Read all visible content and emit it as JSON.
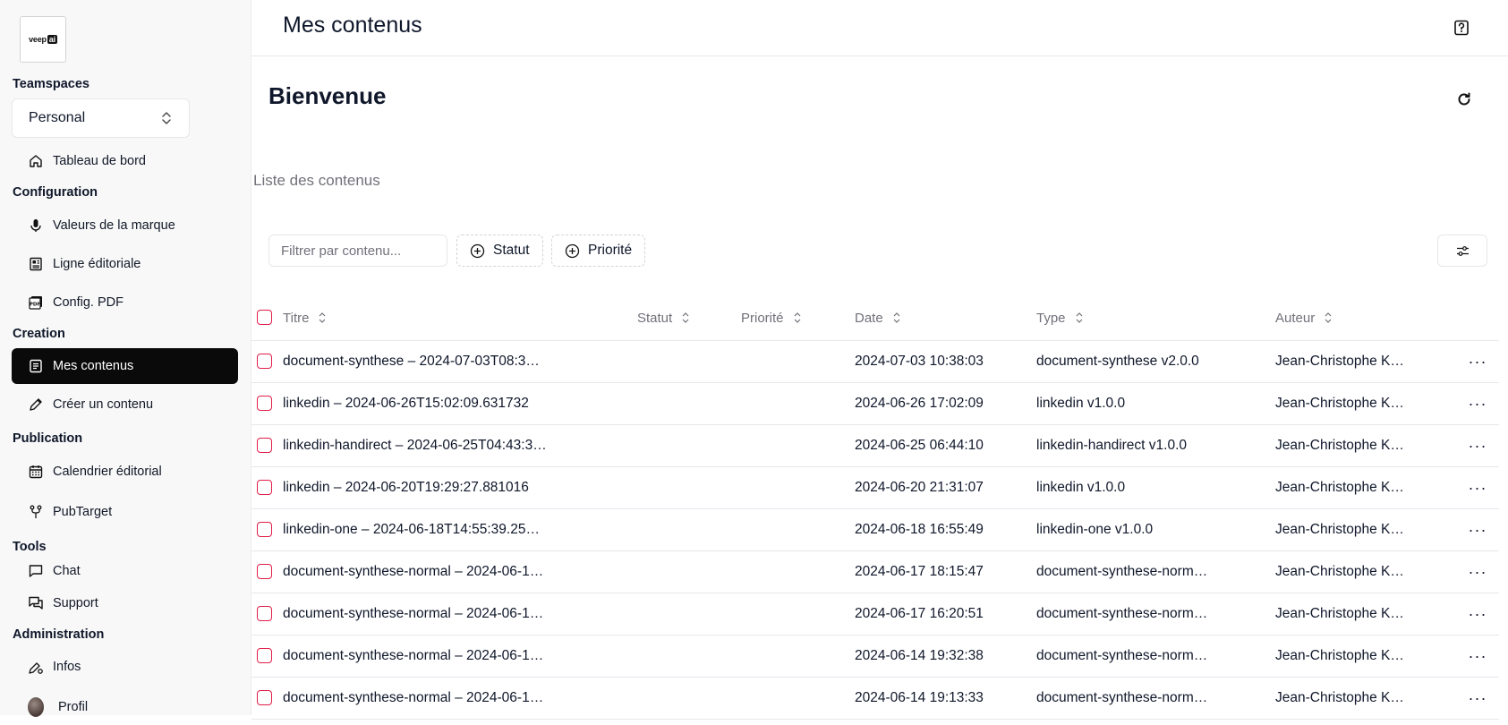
{
  "logo": {
    "brand": "veep",
    "suffix": "ai"
  },
  "sidebar": {
    "teamspaces_title": "Teamspaces",
    "teamspace_value": "Personal",
    "dashboard_label": "Tableau de bord",
    "sections": [
      {
        "title": "Configuration",
        "items": [
          {
            "label": "Valeurs de la marque",
            "icon": "mic-icon"
          },
          {
            "label": "Ligne éditoriale",
            "icon": "newspaper-icon"
          },
          {
            "label": "Config. PDF",
            "icon": "pdf-icon"
          }
        ]
      },
      {
        "title": "Creation",
        "items": [
          {
            "label": "Mes contenus",
            "icon": "document-list-icon",
            "active": true
          },
          {
            "label": "Créer un contenu",
            "icon": "pencil-icon"
          }
        ]
      },
      {
        "title": "Publication",
        "items": [
          {
            "label": "Calendrier éditorial",
            "icon": "calendar-icon"
          },
          {
            "label": "PubTarget",
            "icon": "fork-icon"
          }
        ]
      },
      {
        "title": "Tools",
        "items": [
          {
            "label": "Chat",
            "icon": "chat-icon"
          },
          {
            "label": "Support",
            "icon": "support-chat-icon"
          }
        ]
      },
      {
        "title": "Administration",
        "items": [
          {
            "label": "Infos",
            "icon": "pen-gear-icon"
          },
          {
            "label": "Profil",
            "icon": "avatar"
          }
        ]
      }
    ]
  },
  "header": {
    "title": "Mes contenus"
  },
  "main": {
    "welcome": "Bienvenue",
    "list_title": "Liste des contenus",
    "filter_placeholder": "Filtrer par contenu...",
    "chip_status": "Statut",
    "chip_priority": "Priorité"
  },
  "table": {
    "columns": [
      "Titre",
      "Statut",
      "Priorité",
      "Date",
      "Type",
      "Auteur"
    ],
    "rows": [
      {
        "title": "document-synthese – 2024-07-03T08:3…",
        "status": "",
        "priority": "",
        "date": "2024-07-03 10:38:03",
        "type": "document-synthese v2.0.0",
        "author": "Jean-Christophe K…"
      },
      {
        "title": "linkedin – 2024-06-26T15:02:09.631732",
        "status": "",
        "priority": "",
        "date": "2024-06-26 17:02:09",
        "type": "linkedin v1.0.0",
        "author": "Jean-Christophe K…"
      },
      {
        "title": "linkedin-handirect – 2024-06-25T04:43:3…",
        "status": "",
        "priority": "",
        "date": "2024-06-25 06:44:10",
        "type": "linkedin-handirect v1.0.0",
        "author": "Jean-Christophe K…"
      },
      {
        "title": "linkedin – 2024-06-20T19:29:27.881016",
        "status": "",
        "priority": "",
        "date": "2024-06-20 21:31:07",
        "type": "linkedin v1.0.0",
        "author": "Jean-Christophe K…"
      },
      {
        "title": "linkedin-one – 2024-06-18T14:55:39.25…",
        "status": "",
        "priority": "",
        "date": "2024-06-18 16:55:49",
        "type": "linkedin-one v1.0.0",
        "author": "Jean-Christophe K…"
      },
      {
        "title": "document-synthese-normal – 2024-06-1…",
        "status": "",
        "priority": "",
        "date": "2024-06-17 18:15:47",
        "type": "document-synthese-norm…",
        "author": "Jean-Christophe K…"
      },
      {
        "title": "document-synthese-normal – 2024-06-1…",
        "status": "",
        "priority": "",
        "date": "2024-06-17 16:20:51",
        "type": "document-synthese-norm…",
        "author": "Jean-Christophe K…"
      },
      {
        "title": "document-synthese-normal – 2024-06-1…",
        "status": "",
        "priority": "",
        "date": "2024-06-14 19:32:38",
        "type": "document-synthese-norm…",
        "author": "Jean-Christophe K…"
      },
      {
        "title": "document-synthese-normal – 2024-06-1…",
        "status": "",
        "priority": "",
        "date": "2024-06-14 19:13:33",
        "type": "document-synthese-norm…",
        "author": "Jean-Christophe K…"
      }
    ],
    "row_action": "···"
  },
  "colors": {
    "accent": "#0a0a0a",
    "checkbox_border": "#e11d48",
    "muted_text": "#71717a",
    "border": "#e5e7eb"
  }
}
